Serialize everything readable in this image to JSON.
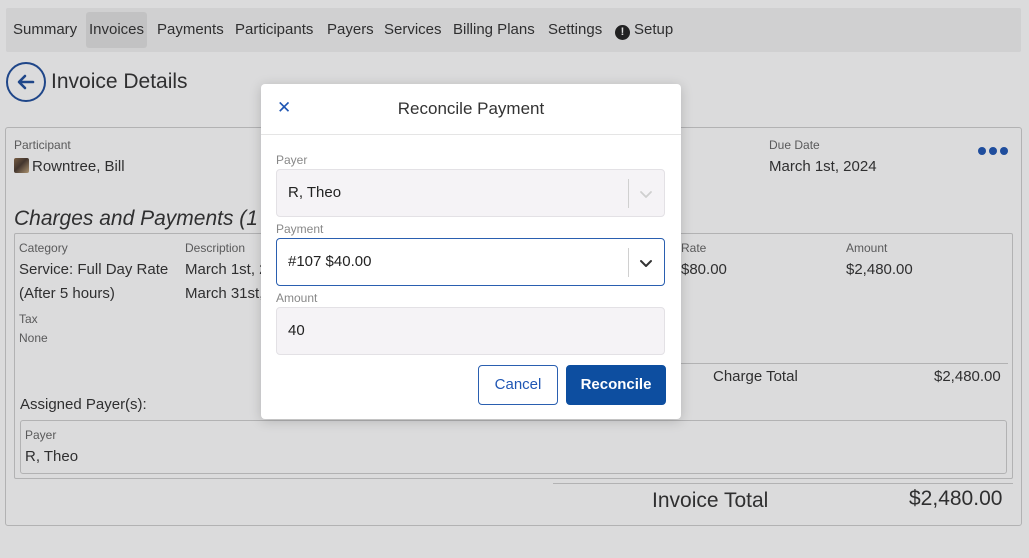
{
  "nav": {
    "items": [
      {
        "label": "Summary"
      },
      {
        "label": "Invoices",
        "active": true
      },
      {
        "label": "Payments"
      },
      {
        "label": "Participants"
      },
      {
        "label": "Payers"
      },
      {
        "label": "Services"
      },
      {
        "label": "Billing Plans"
      },
      {
        "label": "Settings"
      },
      {
        "label": "Setup",
        "icon": "exclamation-circle-icon"
      }
    ]
  },
  "page": {
    "title": "Invoice Details",
    "back_icon": "arrow-left-icon"
  },
  "invoice": {
    "participant_label": "Participant",
    "participant_name": "Rowntree, Bill",
    "due_date_label": "Due Date",
    "due_date": "March 1st, 2024",
    "more_icon": "more-horizontal-icon"
  },
  "charges": {
    "title": "Charges and Payments (1",
    "headers": {
      "category": "Category",
      "description": "Description",
      "rate": "Rate",
      "amount": "Amount"
    },
    "row": {
      "category_line1": "Service: Full Day Rate",
      "category_line2": "(After 5 hours)",
      "description_line1": "March 1st, 2",
      "description_line2": "March 31st,",
      "rate": "$80.00",
      "amount": "$2,480.00"
    },
    "tax_label": "Tax",
    "tax_value": "None",
    "charge_total_label": "Charge Total",
    "charge_total_value": "$2,480.00",
    "assigned_payers_label": "Assigned Payer(s):",
    "payer_label": "Payer",
    "payer_value": "R, Theo"
  },
  "totals": {
    "invoice_total_label": "Invoice Total",
    "invoice_total_value": "$2,480.00"
  },
  "modal": {
    "title": "Reconcile Payment",
    "close_icon": "close-icon",
    "payer_label": "Payer",
    "payer_value": "R, Theo",
    "payment_label": "Payment",
    "payment_value": "#107 $40.00",
    "amount_label": "Amount",
    "amount_value": "40",
    "cancel_label": "Cancel",
    "reconcile_label": "Reconcile"
  },
  "colors": {
    "accent": "#1f56b4",
    "primary_button": "#0d4ea0",
    "nav_bg": "#f2f2f2"
  }
}
